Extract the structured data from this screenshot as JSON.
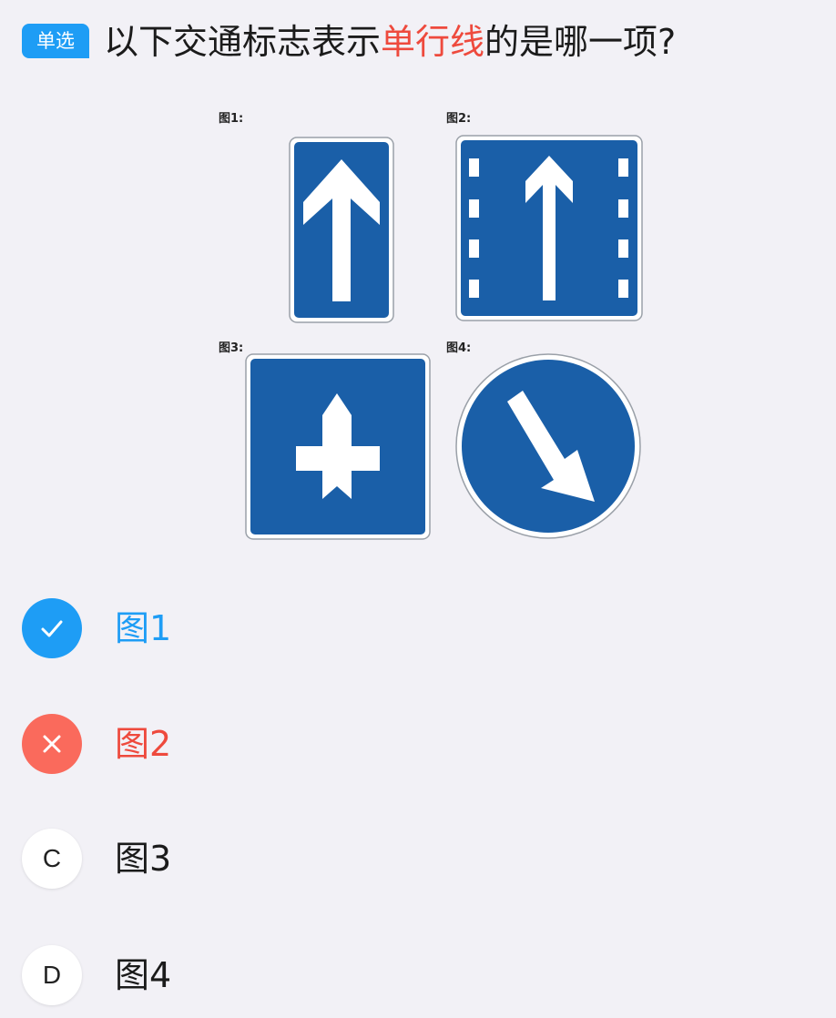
{
  "question": {
    "type_badge": "单选",
    "text_before": "以下交通标志表示",
    "text_highlight": "单行线",
    "text_after": "的是哪一项?"
  },
  "figure": {
    "labels": [
      "图1:",
      "图2:",
      "图3:",
      "图4:"
    ],
    "sign_color": "#1a5fa8",
    "icons": [
      "single-arrow-up-sign-icon",
      "arrow-up-with-lane-dashes-sign-icon",
      "crossroads-priority-sign-icon",
      "keep-right-arrow-sign-icon"
    ]
  },
  "options": [
    {
      "marker": "check-icon",
      "state": "correct",
      "label": "图1"
    },
    {
      "marker": "cross-icon",
      "state": "wrong",
      "label": "图2"
    },
    {
      "marker": "C",
      "state": "none",
      "label": "图3"
    },
    {
      "marker": "D",
      "state": "none",
      "label": "图4"
    }
  ],
  "colors": {
    "accent_blue": "#1e9df5",
    "error_red": "#ee4a3d",
    "error_circle": "#fa6a5c",
    "background": "#f2f1f6"
  }
}
